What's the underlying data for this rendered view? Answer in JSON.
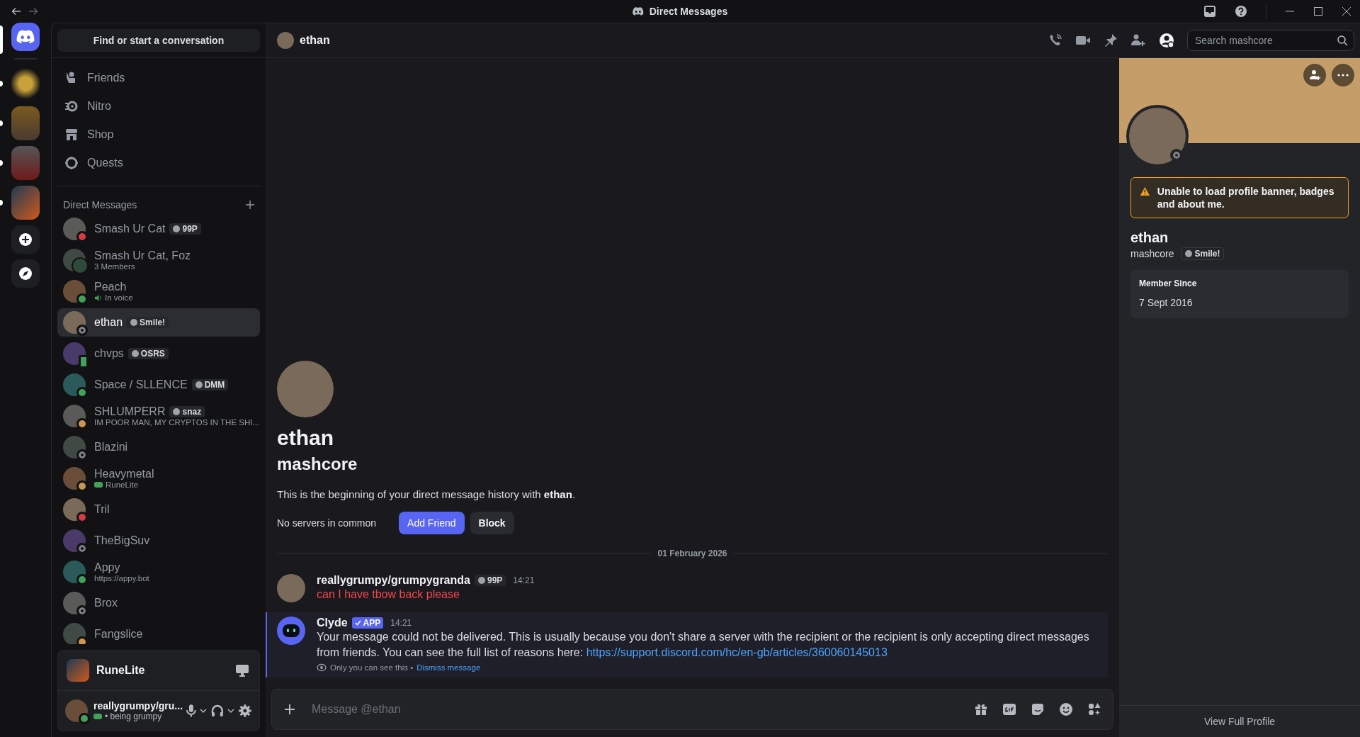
{
  "titlebar": {
    "title": "Direct Messages"
  },
  "home": {
    "selected": true
  },
  "servers": [
    {
      "unread": true
    },
    {
      "unread": true
    },
    {
      "unread": true
    },
    {
      "unread": true
    }
  ],
  "sidebar": {
    "search": "Find or start a conversation",
    "nav": [
      {
        "kind": "friends",
        "label": "Friends"
      },
      {
        "kind": "nitro",
        "label": "Nitro"
      },
      {
        "kind": "shop",
        "label": "Shop"
      },
      {
        "kind": "quests",
        "label": "Quests"
      }
    ],
    "dm_heading": "Direct Messages",
    "dms": [
      {
        "name": "Smash Ur Cat",
        "tag": "99P",
        "status": {
          "kind": "dnd"
        },
        "selected": false
      },
      {
        "name": "Smash Ur Cat, Foz",
        "subtitle": {
          "kind": "plain",
          "text": "3 Members"
        },
        "status": {
          "kind": "group"
        },
        "selected": false
      },
      {
        "name": "Peach",
        "subtitle": {
          "kind": "voice",
          "text": "In voice"
        },
        "status": {
          "kind": "online"
        },
        "selected": false
      },
      {
        "name": "ethan",
        "tag": "Smile!",
        "status": {
          "kind": "offline"
        },
        "selected": true
      },
      {
        "name": "chvps",
        "tag": "OSRS",
        "status": {
          "kind": "mobile"
        },
        "selected": false
      },
      {
        "name": "Space / SLLENCE",
        "tag": "DMM",
        "status": {
          "kind": "online"
        },
        "selected": false
      },
      {
        "name": "SHLUMPERR",
        "tag": "snaz",
        "subtitle": {
          "kind": "plain",
          "text": "IM POOR MAN, MY CRYPTOS IN THE SHI..."
        },
        "status": {
          "kind": "idle"
        },
        "selected": false
      },
      {
        "name": "Blazini",
        "status": {
          "kind": "offline"
        },
        "selected": false
      },
      {
        "name": "Heavymetal",
        "subtitle": {
          "kind": "game",
          "text": "RuneLite"
        },
        "status": {
          "kind": "idle"
        },
        "selected": false
      },
      {
        "name": "Tril",
        "status": {
          "kind": "dnd"
        },
        "selected": false
      },
      {
        "name": "TheBigSuv",
        "status": {
          "kind": "offline"
        },
        "selected": false
      },
      {
        "name": "Appy",
        "subtitle": {
          "kind": "plain",
          "text": "https://appy.bot"
        },
        "status": {
          "kind": "online"
        },
        "selected": false
      },
      {
        "name": "Brox",
        "status": {
          "kind": "offline"
        },
        "selected": false
      },
      {
        "name": "Fangslice",
        "status": {
          "kind": "idle"
        },
        "selected": false
      }
    ],
    "activity": "RuneLite",
    "user": {
      "name": "reallygrumpy/gru...",
      "status": {
        "kind": "online"
      },
      "status_text": "• being grumpy"
    }
  },
  "header": {
    "name": "ethan",
    "search_placeholder": "Search mashcore"
  },
  "intro": {
    "name": "ethan",
    "username": "mashcore",
    "text": "This is the beginning of your direct message history with **ethan**.",
    "mutual": "No servers in common",
    "buttons": [
      "Add Friend",
      "Block"
    ]
  },
  "date_divider": "01 February 2026",
  "messages": [
    {
      "kind": "user",
      "author": "reallygrumpy/grumpygranda",
      "tag": "99P",
      "time": "14:21",
      "text": "can I have tbow back please",
      "failed": true
    },
    {
      "kind": "system",
      "author": "Clyde",
      "tag": "APP",
      "time": "14:21",
      "text": "Your message could not be delivered. This is usually because you don't share a server with the recipient or the recipient is only accepting direct messages from friends. You can see the full list of reasons here: ",
      "link": "https://support.discord.com/hc/en-gb/articles/360060145013",
      "note": "Only you can see this •",
      "dismiss": "Dismiss message"
    }
  ],
  "composer": {
    "placeholder": "Message @ethan"
  },
  "profile": {
    "name": "ethan",
    "username": "mashcore",
    "tag": "Smile!",
    "status": {
      "kind": "offline"
    },
    "warning": "Unable to load profile banner, badges and about me.",
    "member_since_label": "Member Since",
    "member_since": "7 Sept 2016",
    "view_full": "View Full Profile"
  }
}
